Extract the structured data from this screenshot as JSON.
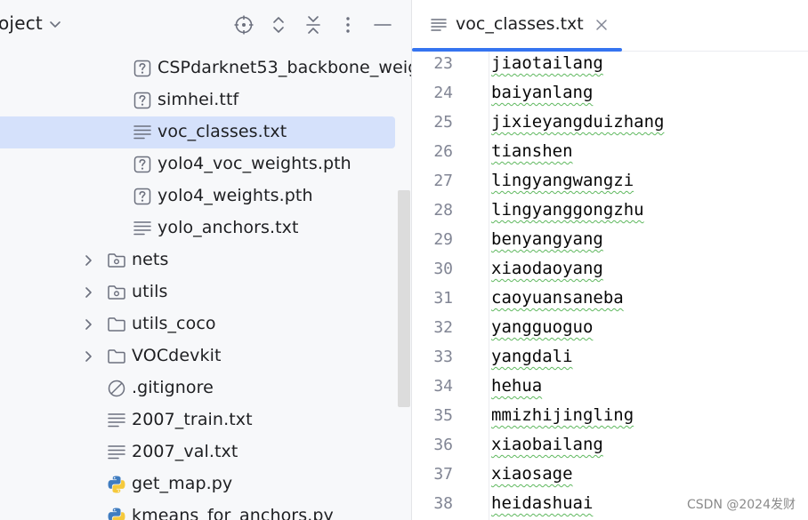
{
  "project_panel": {
    "title": "oject",
    "header_icons": [
      "locate-icon",
      "expand-collapse-icon",
      "collapse-all-icon",
      "more-vertical-icon",
      "minimize-icon"
    ],
    "tree": [
      {
        "label": "CSPdarknet53_backbone_weig",
        "icon": "unknown-file-icon",
        "arrow": false,
        "selected": false
      },
      {
        "label": "simhei.ttf",
        "icon": "unknown-file-icon",
        "arrow": false,
        "selected": false
      },
      {
        "label": "voc_classes.txt",
        "icon": "text-file-icon",
        "arrow": false,
        "selected": true
      },
      {
        "label": "yolo4_voc_weights.pth",
        "icon": "unknown-file-icon",
        "arrow": false,
        "selected": false
      },
      {
        "label": "yolo4_weights.pth",
        "icon": "unknown-file-icon",
        "arrow": false,
        "selected": false
      },
      {
        "label": "yolo_anchors.txt",
        "icon": "text-file-icon",
        "arrow": false,
        "selected": false
      },
      {
        "label": "nets",
        "icon": "package-folder-icon",
        "arrow": true,
        "selected": false
      },
      {
        "label": "utils",
        "icon": "package-folder-icon",
        "arrow": true,
        "selected": false
      },
      {
        "label": "utils_coco",
        "icon": "folder-icon",
        "arrow": true,
        "selected": false
      },
      {
        "label": "VOCdevkit",
        "icon": "folder-icon",
        "arrow": true,
        "selected": false
      },
      {
        "label": ".gitignore",
        "icon": "ignored-file-icon",
        "arrow": false,
        "selected": false
      },
      {
        "label": "2007_train.txt",
        "icon": "text-file-icon",
        "arrow": false,
        "selected": false
      },
      {
        "label": "2007_val.txt",
        "icon": "text-file-icon",
        "arrow": false,
        "selected": false
      },
      {
        "label": "get_map.py",
        "icon": "python-file-icon",
        "arrow": false,
        "selected": false
      },
      {
        "label": "kmeans_for_anchors.py",
        "icon": "python-file-icon",
        "arrow": false,
        "selected": false
      }
    ]
  },
  "editor": {
    "tab": {
      "label": "voc_classes.txt",
      "icon": "text-file-icon",
      "close_icon": "close-icon"
    },
    "lines": [
      {
        "num": "23",
        "text": "jiaotailang"
      },
      {
        "num": "24",
        "text": "baiyanlang"
      },
      {
        "num": "25",
        "text": "jixieyangduizhang"
      },
      {
        "num": "26",
        "text": "tianshen"
      },
      {
        "num": "27",
        "text": "lingyangwangzi"
      },
      {
        "num": "28",
        "text": "lingyanggongzhu"
      },
      {
        "num": "29",
        "text": "benyangyang"
      },
      {
        "num": "30",
        "text": "xiaodaoyang"
      },
      {
        "num": "31",
        "text": "caoyuansaneba"
      },
      {
        "num": "32",
        "text": "yangguoguo"
      },
      {
        "num": "33",
        "text": "yangdali"
      },
      {
        "num": "34",
        "text": "hehua"
      },
      {
        "num": "35",
        "text": "mmizhijingling"
      },
      {
        "num": "36",
        "text": "xiaobailang"
      },
      {
        "num": "37",
        "text": "xiaosage"
      },
      {
        "num": "38",
        "text": "heidashuai"
      }
    ]
  },
  "watermark": "CSDN @2024发财",
  "colors": {
    "selection": "#d5e1fb",
    "accent": "#3574f0",
    "typo_underline": "#5fb85f",
    "line_number": "#818594"
  }
}
